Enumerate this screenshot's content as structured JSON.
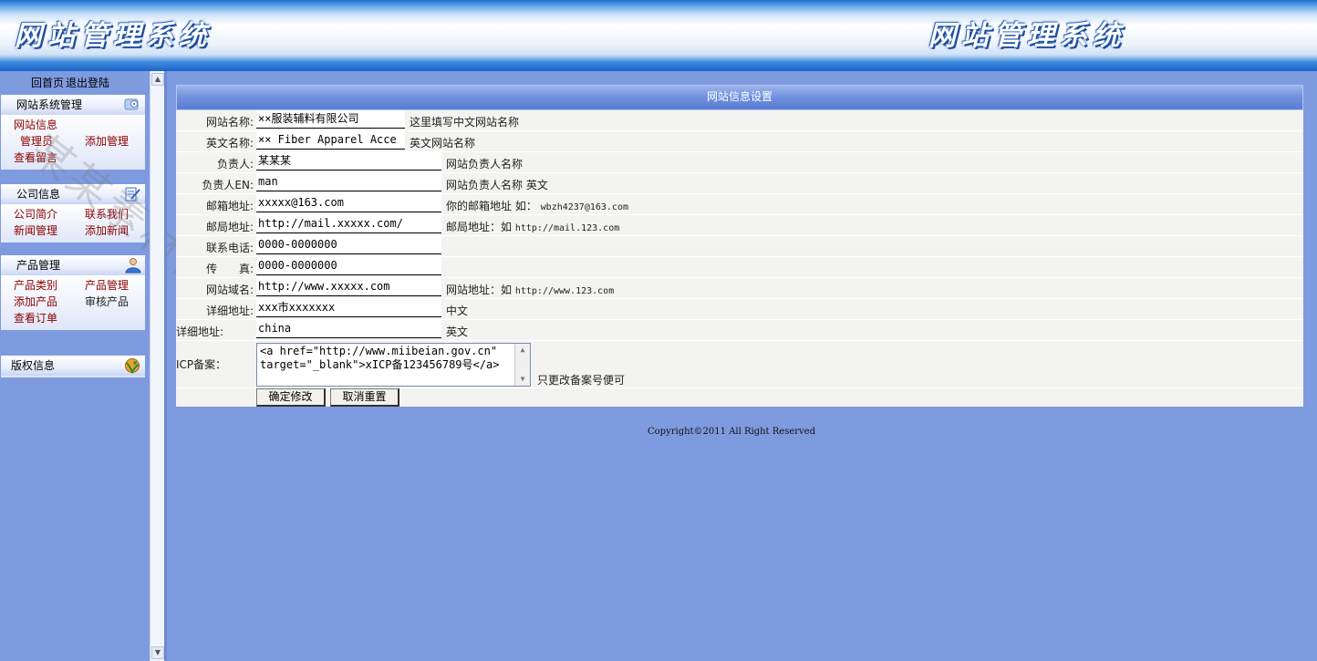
{
  "header": {
    "logo_left": "网站管理系统",
    "logo_right": "网站管理系统"
  },
  "topnav": {
    "home": "回首页",
    "logout": "退出登陆"
  },
  "panels": [
    {
      "title": "网站系统管理",
      "icon": "settings-icon",
      "links": {
        "site_info": "网站信息",
        "admin": "管理员",
        "add_admin": "添加管理",
        "view_messages": "查看留言"
      }
    },
    {
      "title": "公司信息",
      "icon": "edit-note-icon",
      "links": {
        "company_intro": "公司简介",
        "contact_us": "联系我们",
        "news_manage": "新闻管理",
        "add_news": "添加新闻"
      }
    },
    {
      "title": "产品管理",
      "icon": "user-icon",
      "links": {
        "product_category": "产品类别",
        "product_manage": "产品管理",
        "add_product": "添加产品",
        "review_product": "审核产品",
        "view_orders": "查看订单"
      }
    },
    {
      "title": "版权信息",
      "icon": "globe-icon"
    }
  ],
  "form": {
    "title": "网站信息设置",
    "rows": [
      {
        "label": "网站名称:",
        "value": "××服装辅料有限公司",
        "hint": "这里填写中文网站名称"
      },
      {
        "label": "英文名称:",
        "value": "×× Fiber Apparel Acce",
        "hint": "英文网站名称"
      },
      {
        "label": "负责人:",
        "value": "某某某",
        "hint": "网站负责人名称"
      },
      {
        "label": "负责人EN:",
        "value": "man",
        "hint": "网站负责人名称 英文"
      },
      {
        "label": "邮箱地址:",
        "value": "xxxxx@163.com",
        "hint": "你的邮箱地址 如：",
        "hint_mono": "wbzh4237@163.com"
      },
      {
        "label": "邮局地址:",
        "value": "http://mail.xxxxx.com/",
        "hint": "邮局地址：如",
        "hint_mono": "http://mail.123.com"
      },
      {
        "label": "联系电话:",
        "value": "0000-0000000",
        "hint": ""
      },
      {
        "label": "传　　真:",
        "value": "0000-0000000",
        "hint": ""
      },
      {
        "label": "网站域名:",
        "value": "http://www.xxxxx.com",
        "hint": "网站地址：如",
        "hint_mono": "http://www.123.com"
      },
      {
        "label": "详细地址:",
        "value": "xxx市xxxxxxx",
        "hint": "中文"
      },
      {
        "label": "详细地址:",
        "value": "china",
        "hint": "英文"
      }
    ],
    "icp": {
      "label": "ICP备案：",
      "value": "<a href=\"http://www.miibeian.gov.cn\" target=\"_blank\">xICP备123456789号</a>",
      "hint": "只更改备案号便可"
    },
    "submit_label": "确定修改",
    "reset_label": "取消重置"
  },
  "footer": {
    "copyright": "Copyright©2011 All Right Reserved"
  },
  "watermark": "某某素材网"
}
